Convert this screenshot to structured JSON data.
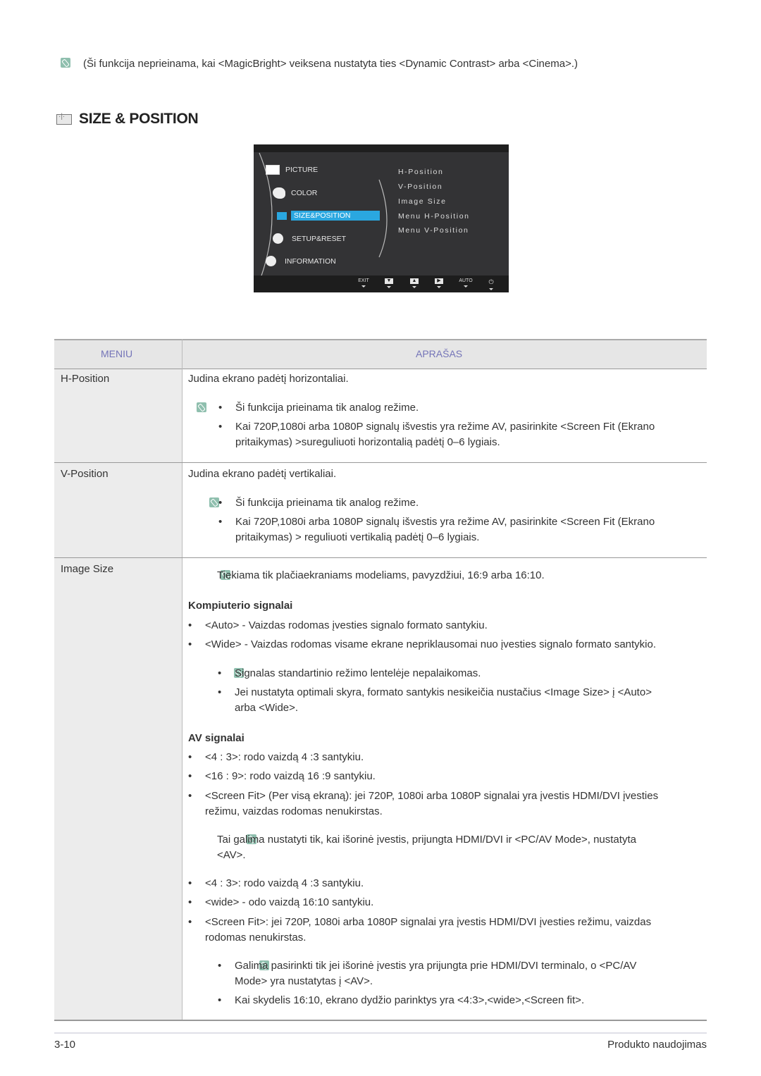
{
  "intro_note": "(Ši funkcija neprieinama, kai <MagicBright> veiksena nustatyta ties <Dynamic Contrast> arba <Cinema>.)",
  "section_title": "SIZE & POSITION",
  "osd": {
    "menu_items": [
      "PICTURE",
      "COLOR",
      "SIZE&POSITION",
      "SETUP&RESET",
      "INFORMATION"
    ],
    "selected_item": "SIZE&POSITION",
    "submenu": [
      "H-Position",
      "V-Position",
      "Image Size",
      "Menu H-Position",
      "Menu V-Position"
    ],
    "buttons": [
      "EXIT",
      "down-icon",
      "up-icon",
      "right-icon",
      "AUTO",
      "power-icon"
    ],
    "exit_label": "EXIT",
    "auto_label": "AUTO",
    "highlight_color": "#2aa7e0"
  },
  "table": {
    "headers": {
      "menu": "MENIU",
      "description": "APRAŠAS"
    },
    "rows": [
      {
        "menu": "H-Position",
        "desc": "Judina ekrano padėtį horizontaliai.",
        "notes": [
          "Ši funkcija prieinama tik analog režime.",
          "Kai 720P,1080i arba 1080P signalų išvestis yra režime AV, pasirinkite <Screen Fit  (Ekrano",
          "pritaikymas) >sureguliuoti horizontalią padėtį 0–6 lygiais."
        ]
      },
      {
        "menu": "V-Position",
        "desc": "Judina ekrano padėtį vertikaliai.",
        "notes": [
          "Ši funkcija prieinama tik analog režime.",
          "Kai 720P,1080i arba 1080P signalų išvestis yra režime AV, pasirinkite <Screen Fit  (Ekrano",
          "pritaikymas) > reguliuoti vertikalią padėtį 0–6 lygiais."
        ]
      },
      {
        "menu": "Image Size",
        "note_top": "Tiekiama tik plačiaekraniams modeliams, pavyzdžiui, 16:9 arba 16:10.",
        "pc_heading": "Kompiuterio signalai",
        "pc_items": [
          "<Auto> - Vaizdas rodomas įvesties signalo formato santykiu.",
          "<Wide> - Vaizdas rodomas visame ekrane nepriklausomai nuo įvesties signalo formato santykio."
        ],
        "pc_notes": [
          "Signalas standartinio režimo lentelėje nepalaikomas.",
          "Jei nustatyta optimali skyra, formato santykis nesikeičia nustačius <Image Size> į <Auto>",
          "arba <Wide>."
        ],
        "av_heading": "AV signalai",
        "av_items": [
          "<4 : 3>: rodo vaizdą 4 :3 santykiu.",
          "<16 : 9>: rodo vaizdą 16 :9 santykiu.",
          "<Screen Fit> (Per visą ekraną): jei 720P, 1080i arba 1080P signalai yra įvestis HDMI/DVI įvesties",
          "režimu, vaizdas rodomas nenukirstas."
        ],
        "av_note": [
          "Tai galima nustatyti tik, kai išorinė įvestis, prijungta HDMI/DVI ir <PC/AV Mode>, nustatyta",
          "<AV>."
        ],
        "av2_items": [
          "<4 : 3>: rodo vaizdą 4 :3 santykiu.",
          "<wide> - odo vaizdą 16:10 santykiu.",
          "<Screen Fit>: jei 720P, 1080i arba 1080P signalai yra įvestis HDMI/DVI įvesties režimu, vaizdas",
          "rodomas nenukirstas."
        ],
        "final_notes": [
          "Galima pasirinkti tik jei išorinė įvestis yra prijungta prie HDMI/DVI terminalo, o <PC/AV",
          "Mode> yra nustatytas į <AV>.",
          "Kai skydelis 16:10, ekrano dydžio parinktys yra <4:3>,<wide>,<Screen fit>."
        ]
      }
    ]
  },
  "footer": {
    "page": "3-10",
    "chapter": "Produkto naudojimas"
  }
}
